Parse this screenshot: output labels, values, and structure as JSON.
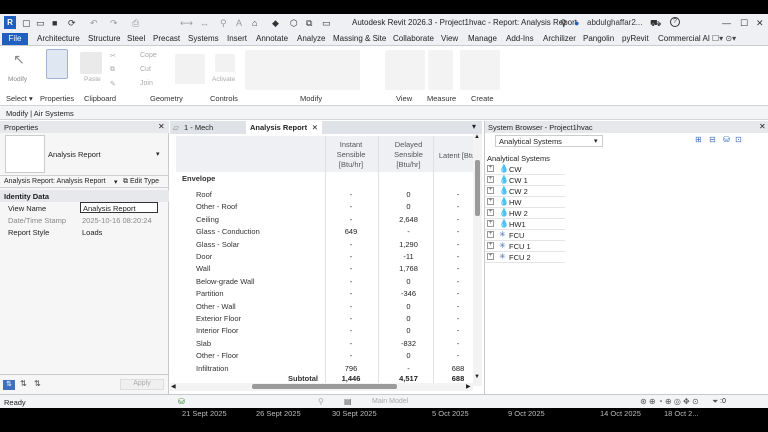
{
  "window": {
    "title": "Autodesk Revit 2026.3 - Project1hvac - Report: Analysis Report",
    "user": "abdulghaffar2...",
    "help": "?"
  },
  "ribbon_tabs": [
    "File",
    "Architecture",
    "Structure",
    "Steel",
    "Precast",
    "Systems",
    "Insert",
    "Annotate",
    "Analyze",
    "Massing & Site",
    "Collaborate",
    "View",
    "Manage",
    "Add-Ins",
    "Archilizer",
    "Pangolin",
    "pyRevit",
    "Commercial AI"
  ],
  "ribbon_groups": {
    "select": "Select",
    "properties": "Properties",
    "clipboard": "Clipboard",
    "geometry": "Geometry",
    "controls": "Controls",
    "modify": "Modify",
    "view": "View",
    "measure": "Measure",
    "create": "Create",
    "modify_button": "Modify",
    "paste_button": "Paste",
    "cope": "Cope",
    "cut": "Cut",
    "join": "Join",
    "activate": "Activate"
  },
  "options_bar": "Modify | Air Systems",
  "properties": {
    "title": "Properties",
    "type_name": "Analysis Report",
    "selector": "Analysis Report: Analysis Report",
    "edit_type": "Edit Type",
    "section": "Identity Data",
    "rows": [
      {
        "k": "View Name",
        "v": "Analysis Report"
      },
      {
        "k": "Date/Time Stamp",
        "v": "2025-10-16 08:20:24"
      },
      {
        "k": "Report Style",
        "v": "Loads"
      }
    ],
    "apply": "Apply"
  },
  "doc_tabs": {
    "tab1": "1 - Mech",
    "tab2": "Analysis Report"
  },
  "report": {
    "headers": {
      "c1": "Instant Sensible [Btu/hr]",
      "c2": "Delayed Sensible [Btu/hr]",
      "c3": "Latent [Btu"
    },
    "section": "Envelope",
    "rows": [
      {
        "label": "Roof",
        "c1": "-",
        "c2": "0",
        "c3": "-"
      },
      {
        "label": "Other - Roof",
        "c1": "-",
        "c2": "0",
        "c3": "-"
      },
      {
        "label": "Ceiling",
        "c1": "-",
        "c2": "2,648",
        "c3": "-"
      },
      {
        "label": "Glass - Conduction",
        "c1": "649",
        "c2": "-",
        "c3": "-"
      },
      {
        "label": "Glass - Solar",
        "c1": "-",
        "c2": "1,290",
        "c3": "-"
      },
      {
        "label": "Door",
        "c1": "-",
        "c2": "-11",
        "c3": "-"
      },
      {
        "label": "Wall",
        "c1": "-",
        "c2": "1,768",
        "c3": "-"
      },
      {
        "label": "Below-grade Wall",
        "c1": "-",
        "c2": "0",
        "c3": "-"
      },
      {
        "label": "Partition",
        "c1": "-",
        "c2": "-346",
        "c3": "-"
      },
      {
        "label": "Other - Wall",
        "c1": "-",
        "c2": "0",
        "c3": "-"
      },
      {
        "label": "Exterior Floor",
        "c1": "-",
        "c2": "0",
        "c3": "-"
      },
      {
        "label": "Interior Floor",
        "c1": "-",
        "c2": "0",
        "c3": "-"
      },
      {
        "label": "Slab",
        "c1": "-",
        "c2": "-832",
        "c3": "-"
      },
      {
        "label": "Other - Floor",
        "c1": "-",
        "c2": "0",
        "c3": "-"
      },
      {
        "label": "Infiltration",
        "c1": "796",
        "c2": "-",
        "c3": "688"
      }
    ],
    "subtotal": {
      "label": "Subtotal",
      "c1": "1,446",
      "c2": "4,517",
      "c3": "688"
    }
  },
  "system_browser": {
    "title": "System Browser - Project1hvac",
    "dropdown": "Analytical Systems",
    "root": "Analytical Systems",
    "items": [
      "CW",
      "CW 1",
      "CW 2",
      "HW",
      "HW 2",
      "HW1",
      "FCU",
      "FCU 1",
      "FCU 2"
    ]
  },
  "status": {
    "ready": "Ready",
    "model": "Main Model",
    "filter": ":0"
  },
  "taskbar_dates": [
    "21 Sept 2025",
    "26 Sept 2025",
    "30 Sept 2025",
    "5 Oct 2025",
    "9 Oct 2025",
    "14 Oct 2025",
    "18 Oct 2..."
  ]
}
